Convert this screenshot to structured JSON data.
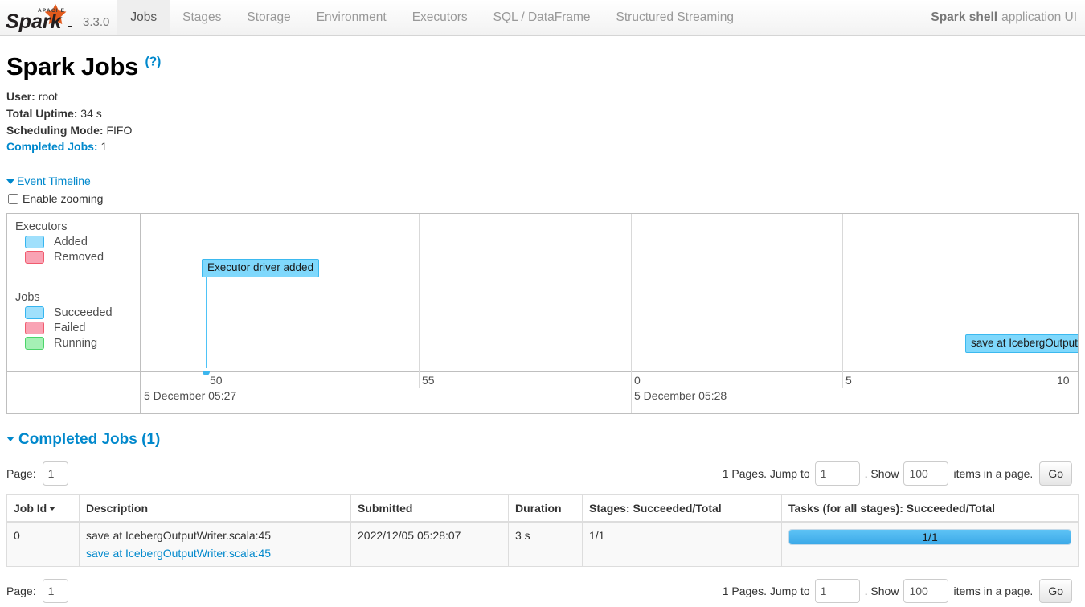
{
  "navbar": {
    "brand_alt": "Apache Spark",
    "version": "3.3.0",
    "tabs": [
      {
        "label": "Jobs",
        "active": true
      },
      {
        "label": "Stages",
        "active": false
      },
      {
        "label": "Storage",
        "active": false
      },
      {
        "label": "Environment",
        "active": false
      },
      {
        "label": "Executors",
        "active": false
      },
      {
        "label": "SQL / DataFrame",
        "active": false
      },
      {
        "label": "Structured Streaming",
        "active": false
      }
    ],
    "app_name": "Spark shell",
    "app_suffix": "application UI"
  },
  "header": {
    "title": "Spark Jobs",
    "help": "(?)"
  },
  "summary": {
    "user_label": "User:",
    "user_value": "root",
    "uptime_label": "Total Uptime:",
    "uptime_value": "34 s",
    "sched_label": "Scheduling Mode:",
    "sched_value": "FIFO",
    "completed_label": "Completed Jobs:",
    "completed_value": "1"
  },
  "event_timeline": {
    "toggle_label": "Event Timeline",
    "zoom_label": "Enable zooming",
    "zoom_checked": false,
    "executors": {
      "group_label": "Executors",
      "legend": [
        {
          "label": "Added",
          "color": "#a0e0fc"
        },
        {
          "label": "Removed",
          "color": "#f9a3b4"
        }
      ]
    },
    "jobs": {
      "group_label": "Jobs",
      "legend": [
        {
          "label": "Succeeded",
          "color": "#a0e0fc"
        },
        {
          "label": "Failed",
          "color": "#f9a3b4"
        },
        {
          "label": "Running",
          "color": "#a5f0b5"
        }
      ]
    },
    "events": [
      {
        "label": "Executor driver added",
        "lane": "executors"
      },
      {
        "label": "save at IcebergOutputWri",
        "lane": "jobs"
      }
    ],
    "axis": {
      "minor_ticks": [
        "50",
        "55",
        "0",
        "5",
        "10"
      ],
      "major_ticks": [
        "5 December 05:27",
        "5 December 05:28"
      ]
    }
  },
  "completed_jobs": {
    "section_title": "Completed Jobs (1)",
    "pager": {
      "page_label": "Page:",
      "page_value": "1",
      "pages_text": "1 Pages. Jump to",
      "jump_value": "1",
      "dot_show": ". Show",
      "show_value": "100",
      "items_text": "items in a page.",
      "go_label": "Go"
    },
    "columns": [
      "Job Id",
      "Description",
      "Submitted",
      "Duration",
      "Stages: Succeeded/Total",
      "Tasks (for all stages): Succeeded/Total"
    ],
    "sorted_column": "Job Id",
    "rows": [
      {
        "job_id": "0",
        "description": "save at IcebergOutputWriter.scala:45",
        "description_link": "save at IcebergOutputWriter.scala:45",
        "submitted": "2022/12/05 05:28:07",
        "duration": "3 s",
        "stages": "1/1",
        "tasks_label": "1/1",
        "tasks_percent": 100
      }
    ]
  },
  "colors": {
    "link": "#0088cc",
    "progress_fill": "#4eb9ef",
    "event_box": "#7fd8fc",
    "row_bg": "#f9f9f9"
  }
}
